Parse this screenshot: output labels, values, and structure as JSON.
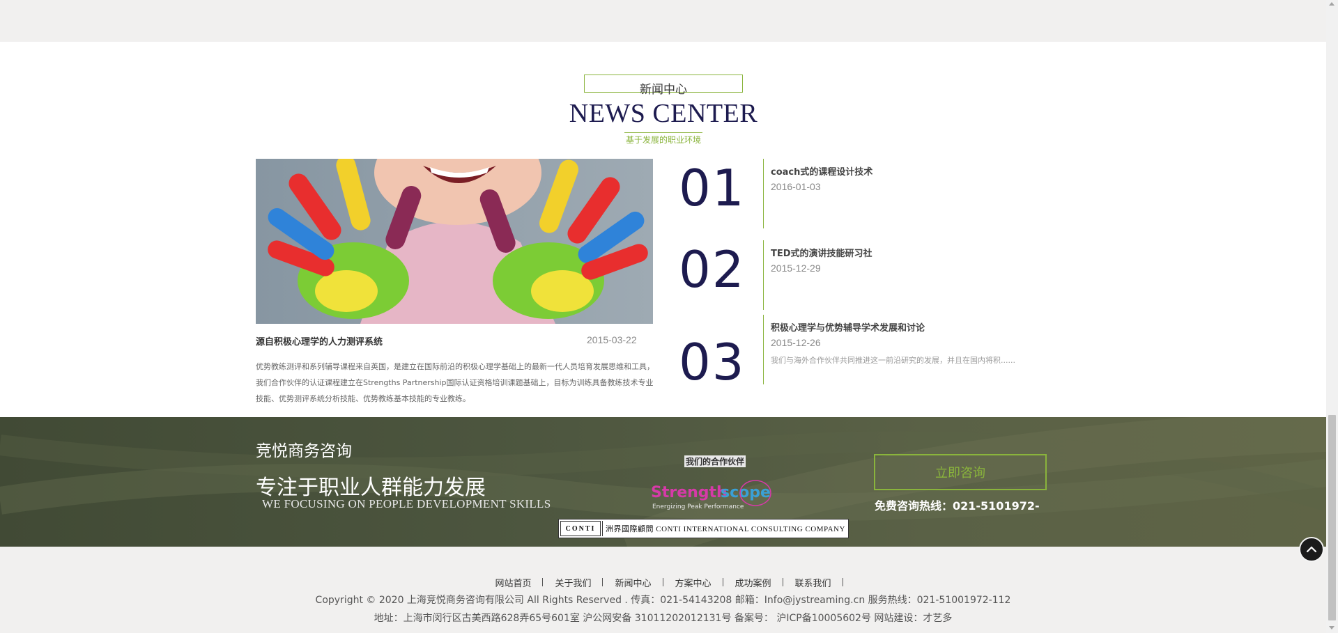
{
  "news_header": {
    "title_cn": "新闻中心",
    "title_en": "NEWS CENTER",
    "subtitle": "基于发展的职业环境"
  },
  "featured": {
    "title": "源自积极心理学的人力测评系统",
    "date": "2015-03-22",
    "description": "优势教练测评和系列辅导课程来自英国，是建立在国际前沿的积极心理学基础上的最新一代人员培育发展思维和工具，我们合作伙伴的认证课程建立在Strengths Partnership国际认证资格培训课题基础上，目标为训练具备教练技术专业技能、优势测评系统分析技能、优势教练基本技能的专业教练。"
  },
  "news_list": [
    {
      "num": "01",
      "title": "coach式的课程设计技术",
      "date": "2016-01-03",
      "summary": ""
    },
    {
      "num": "02",
      "title": "TED式的演讲技能研习社",
      "date": "2015-12-29",
      "summary": ""
    },
    {
      "num": "03",
      "title": "积极心理学与优势辅导学术发展和讨论",
      "date": "2015-12-26",
      "summary": "我们与海外合作伙伴共同推进这一前沿研究的发展，并且在国内将积......"
    }
  ],
  "banner": {
    "company": "竞悦商务咨询",
    "slogan": "专注于职业人群能力发展",
    "slogan_en": "WE FOCUSING ON PEOPLE DEVELOPMENT SKILLS",
    "partners_label": "我们的合作伙伴",
    "strengthscope_text": "Strengthscope",
    "strengthscope_tagline": "Energizing Peak Performance",
    "conti_left": "CONTI",
    "conti_right": "洲界國際顧問 CONTI INTERNATIONAL CONSULTING COMPANY",
    "consult_button": "立即咨询",
    "hotline": "免费咨询热线：021-5101972-"
  },
  "footer": {
    "nav": [
      "网站首页",
      "关于我们",
      "新闻中心",
      "方案中心",
      "成功案例",
      "联系我们"
    ],
    "copyright": "Copyright © 2020 上海竞悦商务咨询有限公司  All Rights Reserved . 传真：021-54143208 邮箱：Info@jystreaming.cn  服务热线：021-51001972-112",
    "address": "地址：上海市闵行区古美西路628弄65号601室     沪公网安备 31011202012131号  备案号： 沪ICP备10005602号   网站建设：才艺多"
  },
  "colors": {
    "accent_green": "#8ab43c",
    "navy": "#1d1b4f",
    "banner_bg": "#4d563f"
  }
}
